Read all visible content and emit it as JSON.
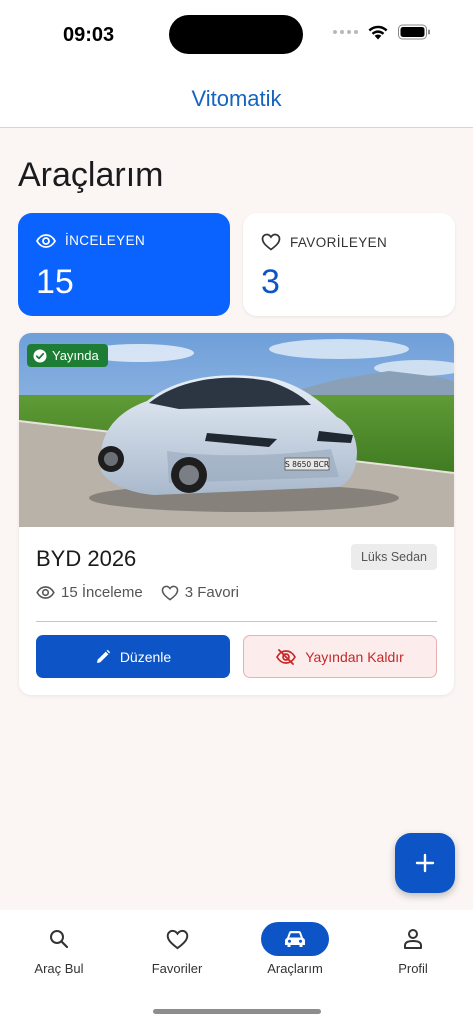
{
  "status_bar": {
    "time": "09:03"
  },
  "header": {
    "title": "Vitomatik"
  },
  "page": {
    "title": "Araçlarım"
  },
  "stats": {
    "views": {
      "label": "İNCELEYEN",
      "value": "15",
      "icon": "eye-icon"
    },
    "favorites": {
      "label": "FAVORİLEYEN",
      "value": "3",
      "icon": "heart-icon"
    }
  },
  "car": {
    "status_badge": "Yayında",
    "name": "BYD 2026",
    "category": "Lüks Sedan",
    "views_text": "15 İnceleme",
    "favorites_text": "3 Favori",
    "plate": "S 8650 BCR",
    "edit_label": "Düzenle",
    "unpublish_label": "Yayından Kaldır"
  },
  "bottom_nav": {
    "items": [
      {
        "label": "Araç Bul",
        "icon": "search-icon",
        "active": false
      },
      {
        "label": "Favoriler",
        "icon": "heart-icon",
        "active": false
      },
      {
        "label": "Araçlarım",
        "icon": "car-icon",
        "active": true
      },
      {
        "label": "Profil",
        "icon": "person-icon",
        "active": false
      }
    ]
  },
  "colors": {
    "primary": "#0d55c6",
    "accent_blue": "#0a63ff",
    "published_green": "#1e7d34",
    "danger_red": "#c62828",
    "background": "#fbf6f4"
  }
}
